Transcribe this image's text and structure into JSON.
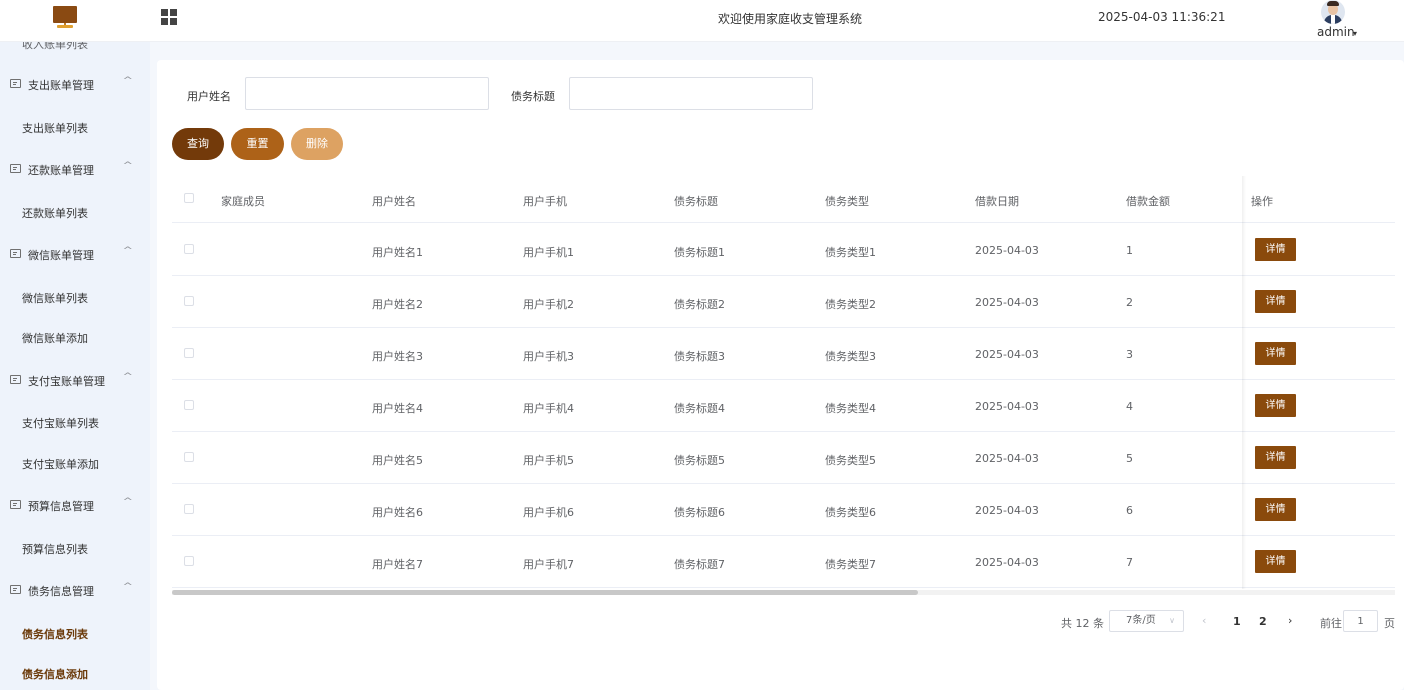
{
  "header": {
    "title": "欢迎使用家庭收支管理系统",
    "datetime": "2025-04-03 11:36:21",
    "username": "admin",
    "caret": "▾"
  },
  "sidebar": {
    "cut_item": "收入账单列表",
    "groups": [
      {
        "label": "支出账单管理",
        "items": [
          "支出账单列表"
        ]
      },
      {
        "label": "还款账单管理",
        "items": [
          "还款账单列表"
        ]
      },
      {
        "label": "微信账单管理",
        "items": [
          "微信账单列表",
          "微信账单添加"
        ]
      },
      {
        "label": "支付宝账单管理",
        "items": [
          "支付宝账单列表",
          "支付宝账单添加"
        ]
      },
      {
        "label": "预算信息管理",
        "items": [
          "预算信息列表"
        ]
      },
      {
        "label": "债务信息管理",
        "items": [
          "债务信息列表",
          "债务信息添加"
        ]
      }
    ],
    "caret_glyph": "^"
  },
  "filters": {
    "username_label": "用户姓名",
    "username_value": "",
    "title_label": "债务标题",
    "title_value": ""
  },
  "buttons": {
    "query": "查询",
    "reset": "重置",
    "delete": "删除"
  },
  "table": {
    "columns": [
      "家庭成员",
      "用户姓名",
      "用户手机",
      "债务标题",
      "债务类型",
      "借款日期",
      "借款金额",
      "操作"
    ],
    "rows": [
      {
        "member": "",
        "name": "用户姓名1",
        "phone": "用户手机1",
        "title": "债务标题1",
        "type": "债务类型1",
        "date": "2025-04-03",
        "amount": "1",
        "action": "详情"
      },
      {
        "member": "",
        "name": "用户姓名2",
        "phone": "用户手机2",
        "title": "债务标题2",
        "type": "债务类型2",
        "date": "2025-04-03",
        "amount": "2",
        "action": "详情"
      },
      {
        "member": "",
        "name": "用户姓名3",
        "phone": "用户手机3",
        "title": "债务标题3",
        "type": "债务类型3",
        "date": "2025-04-03",
        "amount": "3",
        "action": "详情"
      },
      {
        "member": "",
        "name": "用户姓名4",
        "phone": "用户手机4",
        "title": "债务标题4",
        "type": "债务类型4",
        "date": "2025-04-03",
        "amount": "4",
        "action": "详情"
      },
      {
        "member": "",
        "name": "用户姓名5",
        "phone": "用户手机5",
        "title": "债务标题5",
        "type": "债务类型5",
        "date": "2025-04-03",
        "amount": "5",
        "action": "详情"
      },
      {
        "member": "",
        "name": "用户姓名6",
        "phone": "用户手机6",
        "title": "债务标题6",
        "type": "债务类型6",
        "date": "2025-04-03",
        "amount": "6",
        "action": "详情"
      },
      {
        "member": "",
        "name": "用户姓名7",
        "phone": "用户手机7",
        "title": "债务标题7",
        "type": "债务类型7",
        "date": "2025-04-03",
        "amount": "7",
        "action": "详情"
      }
    ]
  },
  "pagination": {
    "total": "共 12 条",
    "page_size": "7条/页",
    "prev": "‹",
    "pages": [
      "1",
      "2"
    ],
    "next": "›",
    "goto_label": "前往",
    "goto_value": "1",
    "page_suffix": "页"
  },
  "colors": {
    "accent_dark": "#733a0a",
    "accent_mid": "#ad6218",
    "accent_light": "#dda262",
    "detail_button": "#8a4a0c"
  }
}
